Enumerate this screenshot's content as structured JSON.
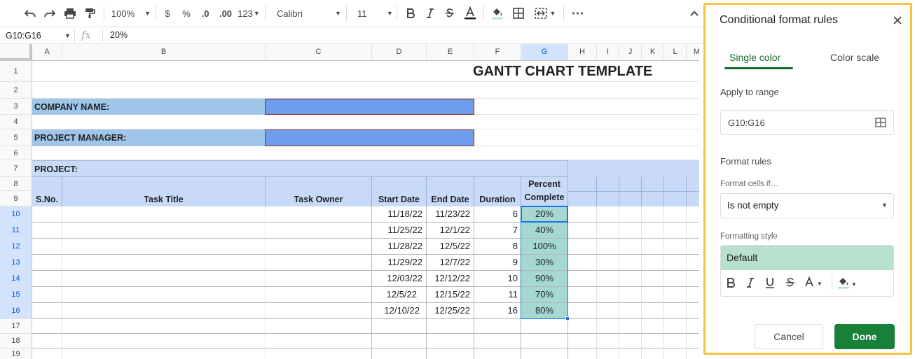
{
  "toolbar": {
    "zoom": "100%",
    "currency": "$",
    "percent": "%",
    "dec_decrease": ".0",
    "dec_increase": ".00",
    "number_format": "123",
    "font": "Calibri",
    "font_size": "11",
    "more": "⋯"
  },
  "formula_bar": {
    "name_box": "G10:G16",
    "fx": "fx",
    "value": "20%"
  },
  "columns": [
    "A",
    "B",
    "C",
    "D",
    "E",
    "F",
    "G",
    "H",
    "I",
    "J",
    "K",
    "L",
    "M"
  ],
  "rows": [
    "1",
    "2",
    "3",
    "4",
    "5",
    "6",
    "7",
    "8",
    "9",
    "10",
    "11",
    "12",
    "13",
    "14",
    "15",
    "16",
    "17",
    "18",
    "19"
  ],
  "sheet": {
    "title": "GANTT CHART TEMPLATE",
    "company_label": "COMPANY NAME:",
    "manager_label": "PROJECT MANAGER:",
    "project_label": "PROJECT:",
    "headers": {
      "sno": "S.No.",
      "task_title": "Task Title",
      "task_owner": "Task Owner",
      "start_date": "Start Date",
      "end_date": "End Date",
      "duration": "Duration",
      "percent_line1": "Percent",
      "percent_line2": "Complete"
    },
    "tasks": [
      {
        "start": "11/18/22",
        "end": "11/23/22",
        "duration": "6",
        "percent": "20%"
      },
      {
        "start": "11/25/22",
        "end": "12/1/22",
        "duration": "7",
        "percent": "40%"
      },
      {
        "start": "11/28/22",
        "end": "12/5/22",
        "duration": "8",
        "percent": "100%"
      },
      {
        "start": "11/29/22",
        "end": "12/7/22",
        "duration": "9",
        "percent": "30%"
      },
      {
        "start": "12/03/22",
        "end": "12/12/22",
        "duration": "10",
        "percent": "90%"
      },
      {
        "start": "12/5/22",
        "end": "12/15/22",
        "duration": "11",
        "percent": "70%"
      },
      {
        "start": "12/10/22",
        "end": "12/25/22",
        "duration": "16",
        "percent": "80%"
      }
    ]
  },
  "panel": {
    "title": "Conditional format rules",
    "tab_single": "Single color",
    "tab_scale": "Color scale",
    "apply_label": "Apply to range",
    "range": "G10:G16",
    "rules_label": "Format rules",
    "cells_if_label": "Format cells if…",
    "condition": "Is not empty",
    "style_label": "Formatting style",
    "style_preview": "Default",
    "cancel": "Cancel",
    "done": "Done"
  },
  "colors": {
    "accent_green": "#146c2e",
    "done_bg": "#188038",
    "label_blue": "#9fc5e8",
    "input_blue": "#6d9eeb",
    "header_blue": "#c9daf8",
    "cf_teal": "#a5d8d0",
    "highlight": "#f4c542"
  }
}
